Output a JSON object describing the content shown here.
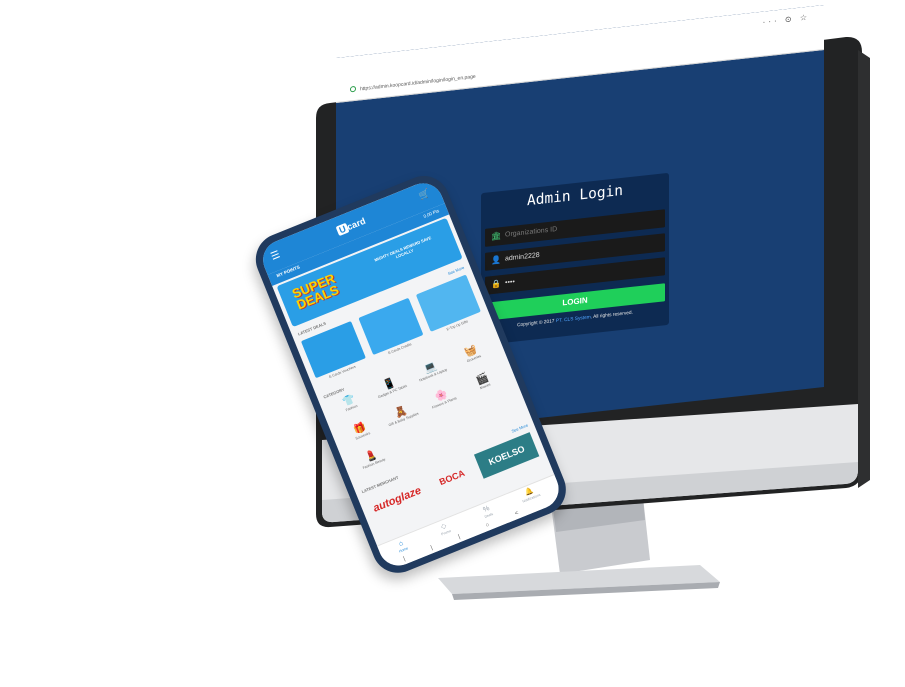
{
  "desktop": {
    "browser": {
      "url": "https://admin.koopcard.id/admin/login/login_en.page",
      "icons": [
        "more-icon",
        "pocket-icon",
        "star-icon"
      ],
      "icon_glyphs": [
        "···",
        "⊙",
        "☆"
      ]
    },
    "login": {
      "title": "Admin Login",
      "org_placeholder": "Organizations ID",
      "username_value": "admin2228",
      "password_value": "••••",
      "submit_label": "LOGIN",
      "copyright_prefix": "Copyright © 2017",
      "copyright_link": "PT. CLS System",
      "copyright_suffix": "All rights reserved."
    },
    "colors": {
      "screen_bg": "#183f73",
      "card_bg": "#0d2a52",
      "button": "#1fcf5a"
    }
  },
  "phone": {
    "app": {
      "logo_box": "U",
      "logo_text": "card",
      "points_label": "MY POINTS",
      "points_value": "0,00 Pts"
    },
    "banner": {
      "title_top": "SUPER",
      "title_bottom": "DEALS",
      "subtitle": "MIGHTY DEALS REWARD SAVE LOCALLY"
    },
    "sections": {
      "deals": "LATEST DEALS",
      "see_more": "See More",
      "categories": "CATEGORY",
      "merchants": "LATEST MERCHANT"
    },
    "deals": [
      "E-Cards Vouchers",
      "E-Cards Credits",
      "E-Top Up Gifts"
    ],
    "categories": [
      {
        "label": "Fashion",
        "icon": "shirt-icon",
        "glyph": "👕"
      },
      {
        "label": "Gadget & PC Tablet",
        "icon": "phone-icon",
        "glyph": "📱"
      },
      {
        "label": "Notebook & Laptop",
        "icon": "laptop-icon",
        "glyph": "💻"
      },
      {
        "label": "Groceries",
        "icon": "basket-icon",
        "glyph": "🧺"
      },
      {
        "label": "Souvenirs",
        "icon": "gift-icon",
        "glyph": "🎁"
      },
      {
        "label": "Gift & Baby Supplies",
        "icon": "toy-icon",
        "glyph": "🧸"
      },
      {
        "label": "Flowers & Plants",
        "icon": "flower-icon",
        "glyph": "🌸"
      },
      {
        "label": "Movies",
        "icon": "film-icon",
        "glyph": "🎬"
      },
      {
        "label": "Fashion Beauty",
        "icon": "cosmetic-icon",
        "glyph": "💄"
      }
    ],
    "brands": [
      "autoglaze",
      "BOCA",
      "KOELSO"
    ],
    "nav": [
      {
        "label": "Home",
        "icon": "home-icon",
        "glyph": "⌂"
      },
      {
        "label": "Promo",
        "icon": "tag-icon",
        "glyph": "◇"
      },
      {
        "label": "Deals",
        "icon": "percent-icon",
        "glyph": "%"
      },
      {
        "label": "Notifications",
        "icon": "bell-icon",
        "glyph": "🔔"
      }
    ],
    "android_keys": [
      "|||",
      "○",
      "<"
    ]
  }
}
